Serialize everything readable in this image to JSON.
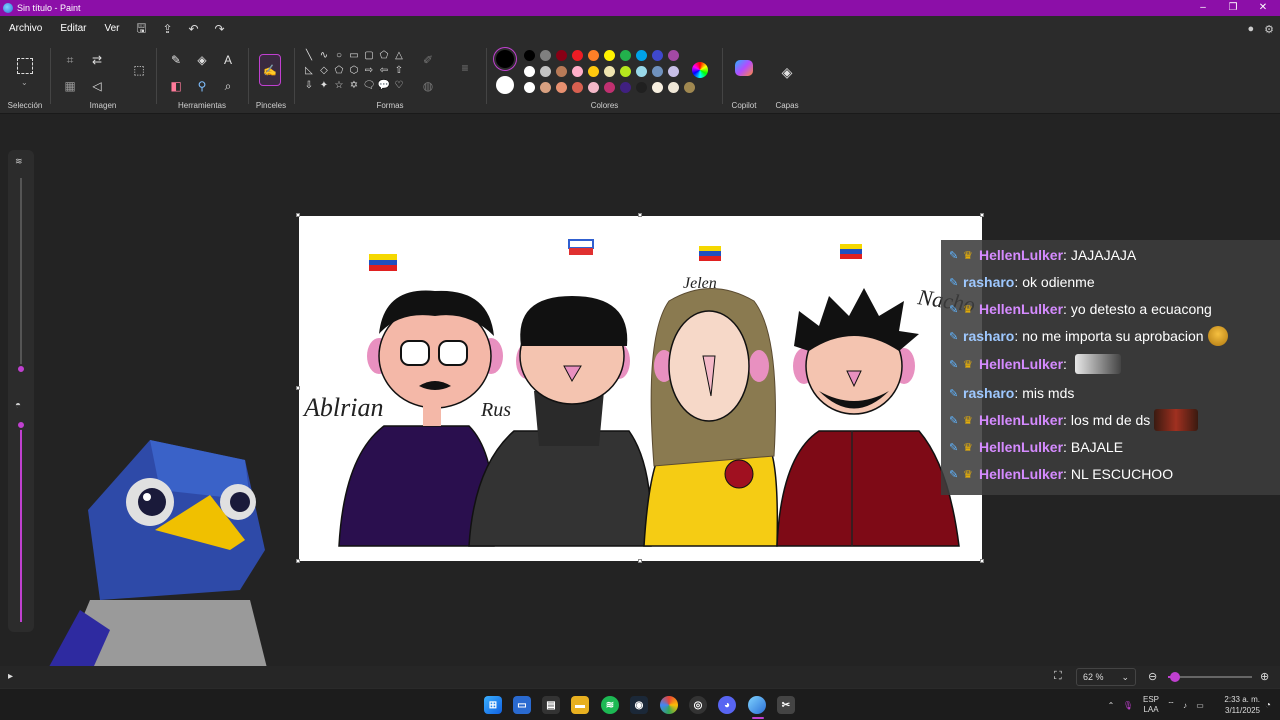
{
  "window": {
    "title": "Sin título - Paint"
  },
  "menu": {
    "items": [
      "Archivo",
      "Editar",
      "Ver"
    ]
  },
  "ribbon": {
    "groups": {
      "selection": "Selección",
      "image": "Imagen",
      "tools": "Herramientas",
      "brushes": "Pinceles",
      "shapes": "Formas",
      "colors": "Colores",
      "copilot": "Copilot",
      "layers": "Capas"
    },
    "palette_row1": [
      "#000000",
      "#7f7f7f",
      "#880015",
      "#ed1c24",
      "#ff7f27",
      "#fff200",
      "#22b14c",
      "#00a2e8",
      "#3f48cc",
      "#a349a4"
    ],
    "palette_row2": [
      "#ffffff",
      "#c3c3c3",
      "#b97a57",
      "#ffaec9",
      "#ffc90e",
      "#efe4b0",
      "#b5e61d",
      "#99d9ea",
      "#7092be",
      "#c8bfe7"
    ],
    "palette_row3": [
      "#ffffff",
      "#d8a080",
      "#e89070",
      "#d86050",
      "#f4b8c8",
      "#c03070",
      "#402080",
      "#202020",
      "#f8f0e0",
      "#f0e8d8",
      "#a08850"
    ]
  },
  "canvas_labels": {
    "name1": "Ablrian",
    "name2": "Rus",
    "name3": "Jelen",
    "name4": "Nacho"
  },
  "chat": {
    "messages": [
      {
        "user": "HellenLulker",
        "text": "JAJAJAJA",
        "color": "#d58bff",
        "crown": true
      },
      {
        "user": "rasharo",
        "text": "ok odienme",
        "color": "#9ec8ff",
        "crown": false
      },
      {
        "user": "HellenLulker",
        "text": "yo detesto a ecuacong",
        "color": "#d58bff",
        "crown": true
      },
      {
        "user": "rasharo",
        "text": "no me importa su aprobacion",
        "color": "#9ec8ff",
        "crown": false
      },
      {
        "user": "HellenLulker",
        "text": "",
        "color": "#d58bff",
        "crown": true
      },
      {
        "user": "rasharo",
        "text": "mis mds",
        "color": "#9ec8ff",
        "crown": false
      },
      {
        "user": "HellenLulker",
        "text": "los md de ds",
        "color": "#d58bff",
        "crown": true
      },
      {
        "user": "HellenLulker",
        "text": "BAJALE",
        "color": "#d58bff",
        "crown": true
      },
      {
        "user": "HellenLulker",
        "text": "NL ESCUCHOO",
        "color": "#d58bff",
        "crown": true
      }
    ]
  },
  "statusbar": {
    "zoom": "62 %",
    "zoom_level_fraction": 0.08
  },
  "taskbar": {
    "language": "ESP",
    "layout": "LAA",
    "time": "2:33 a. m.",
    "date": "3/11/2025"
  }
}
